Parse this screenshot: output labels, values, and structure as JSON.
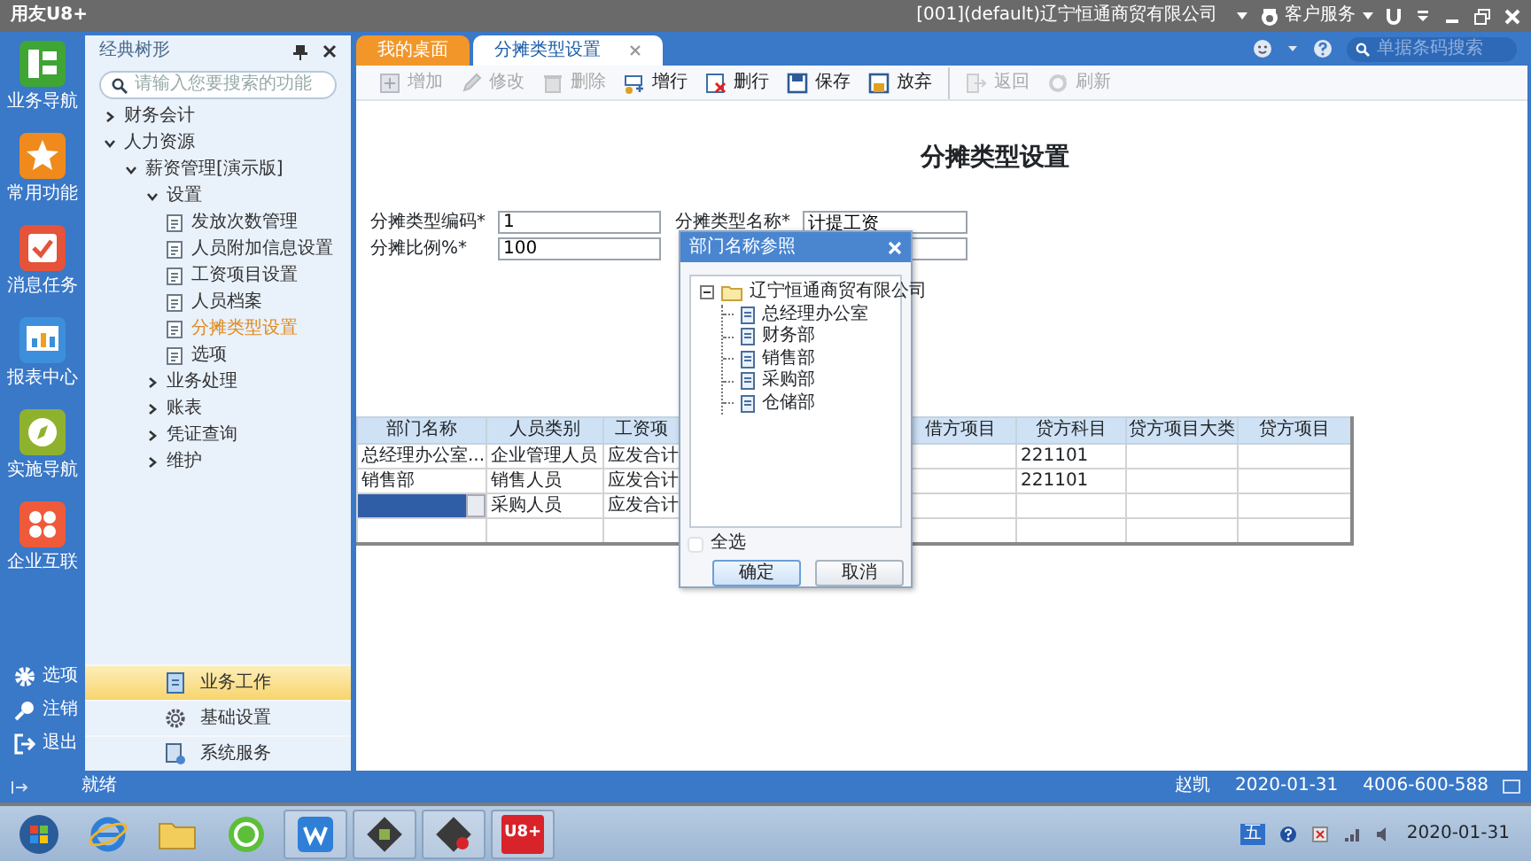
{
  "title_bar": {
    "app_name": "用友U8+",
    "account": "[001](default)辽宁恒通商贸有限公司",
    "service": "客户服务"
  },
  "nav_rail": {
    "items": [
      {
        "label": "业务导航",
        "kind": "grid",
        "color": "#3fa535"
      },
      {
        "label": "常用功能",
        "kind": "star",
        "color": "#f08a1c"
      },
      {
        "label": "消息任务",
        "kind": "check",
        "color": "#e5533a"
      },
      {
        "label": "报表中心",
        "kind": "chart",
        "color": "#3d8fdc"
      },
      {
        "label": "实施导航",
        "kind": "compass",
        "color": "#8fb22e"
      },
      {
        "label": "企业互联",
        "kind": "network",
        "color": "#ef5a3a"
      }
    ],
    "bottom": [
      {
        "label": "选项",
        "kind": "gear"
      },
      {
        "label": "注销",
        "kind": "key"
      },
      {
        "label": "退出",
        "kind": "exit"
      }
    ]
  },
  "tree_panel": {
    "title": "经典树形",
    "search_placeholder": "请输入您要搜索的功能",
    "tree": [
      {
        "label": "财务会计",
        "kind": "folder",
        "expanded": false,
        "selected": false
      },
      {
        "label": "人力资源",
        "kind": "folder",
        "expanded": true,
        "selected": false,
        "children": [
          {
            "label": "薪资管理[演示版]",
            "kind": "folder",
            "expanded": true,
            "selected": false,
            "children": [
              {
                "label": "设置",
                "kind": "folder",
                "expanded": true,
                "selected": false,
                "children": [
                  {
                    "label": "发放次数管理",
                    "kind": "page",
                    "selected": false
                  },
                  {
                    "label": "人员附加信息设置",
                    "kind": "page",
                    "selected": false
                  },
                  {
                    "label": "工资项目设置",
                    "kind": "page",
                    "selected": false
                  },
                  {
                    "label": "人员档案",
                    "kind": "page",
                    "selected": false
                  },
                  {
                    "label": "分摊类型设置",
                    "kind": "page",
                    "selected": true
                  },
                  {
                    "label": "选项",
                    "kind": "page",
                    "selected": false
                  }
                ]
              },
              {
                "label": "业务处理",
                "kind": "folder",
                "expanded": false,
                "selected": false
              },
              {
                "label": "账表",
                "kind": "folder",
                "expanded": false,
                "selected": false
              },
              {
                "label": "凭证查询",
                "kind": "folder",
                "expanded": false,
                "selected": false
              },
              {
                "label": "维护",
                "kind": "folder",
                "expanded": false,
                "selected": false
              }
            ]
          }
        ]
      }
    ],
    "modules": [
      {
        "label": "业务工作",
        "selected": true
      },
      {
        "label": "基础设置",
        "selected": false
      },
      {
        "label": "系统服务",
        "selected": false
      }
    ]
  },
  "tabs": [
    {
      "label": "我的桌面",
      "selected": false,
      "closable": false
    },
    {
      "label": "分摊类型设置",
      "selected": true,
      "closable": true
    }
  ],
  "header_search": {
    "placeholder": "单据条码搜索"
  },
  "toolbar": [
    {
      "label": "增加",
      "disabled": true,
      "separator_before": false
    },
    {
      "label": "修改",
      "disabled": true,
      "separator_before": false
    },
    {
      "label": "删除",
      "disabled": true,
      "separator_before": false
    },
    {
      "label": "增行",
      "disabled": false,
      "separator_before": false
    },
    {
      "label": "删行",
      "disabled": false,
      "separator_before": false
    },
    {
      "label": "保存",
      "disabled": false,
      "separator_before": false
    },
    {
      "label": "放弃",
      "disabled": false,
      "separator_before": false
    },
    {
      "label": "返回",
      "disabled": true,
      "separator_before": true
    },
    {
      "label": "刷新",
      "disabled": true,
      "separator_before": false
    }
  ],
  "form": {
    "title": "分摊类型设置",
    "fields": [
      {
        "label": "分摊类型编码*",
        "value": "1"
      },
      {
        "label": "分摊类型名称*",
        "value": "计提工资"
      },
      {
        "label": "分摊比例%*",
        "value": "100"
      }
    ]
  },
  "table": {
    "columns": [
      "部门名称",
      "人员类别",
      "工资项",
      "借方项目",
      "贷方科目",
      "贷方项目大类",
      "贷方项目"
    ],
    "rows": [
      {
        "editing": false,
        "cells": [
          "总经理办公室...",
          "企业管理人员",
          "应发合计",
          null,
          "221101",
          null,
          null
        ]
      },
      {
        "editing": false,
        "cells": [
          "销售部",
          "销售人员",
          "应发合计",
          null,
          "221101",
          null,
          null
        ]
      },
      {
        "editing": true,
        "cells": [
          null,
          "采购人员",
          "应发合计",
          null,
          null,
          null,
          null
        ]
      },
      {
        "editing": false,
        "cells": [
          null,
          null,
          null,
          null,
          null,
          null,
          null
        ]
      }
    ]
  },
  "dialog": {
    "title": "部门名称参照",
    "tree": {
      "label": "辽宁恒通商贸有限公司",
      "expanded": true,
      "children": [
        {
          "label": "总经理办公室"
        },
        {
          "label": "财务部"
        },
        {
          "label": "销售部"
        },
        {
          "label": "采购部"
        },
        {
          "label": "仓储部"
        }
      ]
    },
    "select_all": {
      "label": "全选",
      "checked": false
    },
    "buttons": [
      {
        "label": "确定",
        "default": true
      },
      {
        "label": "取消",
        "default": false
      }
    ]
  },
  "status_bar": {
    "status": "就绪",
    "user": "赵凯",
    "date": "2020-01-31",
    "phone": "4006-600-588"
  },
  "taskbar": {
    "app_badge": "U8+",
    "ime": "五",
    "date": "2020-01-31"
  }
}
